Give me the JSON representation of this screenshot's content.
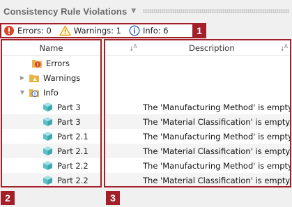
{
  "panel": {
    "title": "Consistency Rule Violations"
  },
  "filters": {
    "errors": "Errors: 0",
    "warnings": "Warnings: 1",
    "info": "Info: 6"
  },
  "callouts": [
    "1",
    "2",
    "3"
  ],
  "tree": {
    "header": "Name",
    "nodes": [
      {
        "label": "Errors",
        "icon": "folder-error-icon",
        "expander": ""
      },
      {
        "label": "Warnings",
        "icon": "folder-warning-icon",
        "expander": "▶"
      },
      {
        "label": "Info",
        "icon": "folder-info-icon",
        "expander": "▼"
      },
      {
        "label": "Part 3",
        "icon": "part-cube-icon"
      },
      {
        "label": "Part 3",
        "icon": "part-cube-icon"
      },
      {
        "label": "Part 2.1",
        "icon": "part-cube-icon"
      },
      {
        "label": "Part 2.1",
        "icon": "part-cube-icon"
      },
      {
        "label": "Part 2.2",
        "icon": "part-cube-icon"
      },
      {
        "label": "Part 2.2",
        "icon": "part-cube-icon"
      }
    ]
  },
  "table": {
    "header": "Description",
    "rows": [
      "",
      "",
      "",
      "The 'Manufacturing Method' is empty.",
      "The 'Material Classification' is empty.",
      "The 'Manufacturing Method' is empty.",
      "The 'Material Classification' is empty.",
      "The 'Manufacturing Method' is empty.",
      "The 'Material Classification' is empty."
    ]
  },
  "colors": {
    "callout": "#a3202a",
    "error": "#d9482b",
    "warning": "#e8a317",
    "info": "#2f62c4",
    "folder": "#e9b44c",
    "part": "#5cc0c7"
  }
}
